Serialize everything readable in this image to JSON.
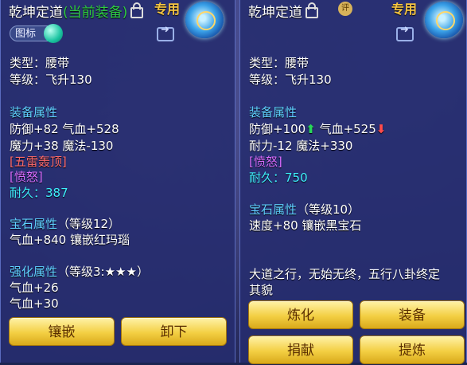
{
  "left": {
    "title": "乾坤定道",
    "title_suffix": "(当前装备)",
    "zhuanyong": "专用",
    "tag_label": "图标",
    "type": "类型：腰带",
    "level": "等级：飞升130",
    "attr_header": "装备属性",
    "attr_lines": [
      "防御+82 气血+528",
      "魔力+38 魔法-130"
    ],
    "special1": "[五雷轰顶]",
    "special2": "[愤怒]",
    "durability_label": "耐久：",
    "durability_value": "387",
    "gem_header": "宝石属性",
    "gem_level": "（等级12）",
    "gem_line": "气血+840 镶嵌红玛瑙",
    "enhance_header": "强化属性",
    "enhance_level": "（等级3:★★★）",
    "enhance_lines": [
      "气血+26",
      "气血+30"
    ],
    "buttons": {
      "inlay": "镶嵌",
      "unequip": "卸下"
    }
  },
  "right": {
    "title": "乾坤定道",
    "zhuanyong": "专用",
    "jewel": "评",
    "type": "类型：腰带",
    "level": "等级：飞升130",
    "attr_header": "装备属性",
    "attr_line1_a": "防御+100",
    "attr_line1_b": "气血+525",
    "attr_line2": "耐力-12 魔法+330",
    "special": "[愤怒]",
    "durability_label": "耐久：",
    "durability_value": "750",
    "gem_header": "宝石属性",
    "gem_level": "（等级10）",
    "gem_line": "速度+80 镶嵌黑宝石",
    "desc_line1": "大道之行，无始无终，五行八卦终定",
    "desc_line2": "其貌",
    "buttons": {
      "refine": "炼化",
      "equip": "装备",
      "donate": "捐献",
      "extract": "提炼"
    }
  },
  "colors": {
    "section": "#5fd0ff",
    "gold_button": "#f3cf43",
    "up_arrow": "#28d65a",
    "down_arrow": "#ff4b4b"
  }
}
